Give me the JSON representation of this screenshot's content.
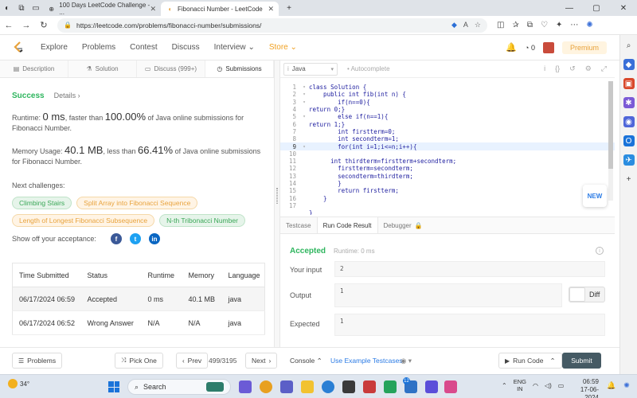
{
  "browser": {
    "tabs": [
      {
        "title": "100 Days LeetCode Challenge - ..."
      },
      {
        "title": "Fibonacci Number - LeetCode"
      }
    ],
    "url": "https://leetcode.com/problems/fibonacci-number/submissions/"
  },
  "nav": {
    "links": [
      "Explore",
      "Problems",
      "Contest",
      "Discuss",
      "Interview",
      "Store"
    ],
    "notification_count": "0",
    "premium": "Premium"
  },
  "problem_tabs": [
    {
      "label": "Description"
    },
    {
      "label": "Solution"
    },
    {
      "label": "Discuss (999+)"
    },
    {
      "label": "Submissions"
    }
  ],
  "result": {
    "status": "Success",
    "details": "Details",
    "runtime_prefix": "Runtime: ",
    "runtime_value": "0 ms",
    "runtime_mid": ", faster than ",
    "runtime_pct": "100.00%",
    "runtime_suffix": " of Java online submissions for Fibonacci Number.",
    "memory_prefix": "Memory Usage: ",
    "memory_value": "40.1 MB",
    "memory_mid": ", less than ",
    "memory_pct": "66.41%",
    "memory_suffix": " of Java online submissions for Fibonacci Number.",
    "next_label": "Next challenges:",
    "challenges": [
      {
        "label": "Climbing Stairs",
        "difficulty": "easy"
      },
      {
        "label": "Split Array into Fibonacci Sequence",
        "difficulty": "medium"
      },
      {
        "label": "Length of Longest Fibonacci Subsequence",
        "difficulty": "medium"
      },
      {
        "label": "N-th Tribonacci Number",
        "difficulty": "easy"
      }
    ],
    "share_label": "Show off your acceptance:"
  },
  "submissions": {
    "headers": [
      "Time Submitted",
      "Status",
      "Runtime",
      "Memory",
      "Language"
    ],
    "rows": [
      {
        "time": "06/17/2024 06:59",
        "status": "Accepted",
        "runtime": "0 ms",
        "memory": "40.1 MB",
        "language": "java"
      },
      {
        "time": "06/17/2024 06:52",
        "status": "Wrong Answer",
        "runtime": "N/A",
        "memory": "N/A",
        "language": "java"
      }
    ]
  },
  "editor": {
    "language": "Java",
    "autocomplete": "Autocomplete",
    "lines": [
      "class Solution {",
      "    public int fib(int n) {",
      "        if(n==0){",
      "return 0;}",
      "        else if(n==1){",
      "return 1;}",
      "        int firstterm=0;",
      "        int secondterm=1;",
      "        for(int i=1;i<=n;i++){",
      "",
      "      int thirdterm=firstterm+secondterm;",
      "        firstterm=secondterm;",
      "        secondterm=thirdterm;",
      "        }",
      "        return firstterm;",
      "    }",
      "",
      "}"
    ],
    "new_badge": "NEW"
  },
  "result_tabs": [
    {
      "label": "Testcase"
    },
    {
      "label": "Run Code Result"
    },
    {
      "label": "Debugger"
    }
  ],
  "run_result": {
    "status": "Accepted",
    "runtime": "Runtime: 0 ms",
    "input_label": "Your input",
    "input_value": "2",
    "output_label": "Output",
    "output_value": "1",
    "expected_label": "Expected",
    "expected_value": "1",
    "diff_label": "Diff"
  },
  "bottom": {
    "problems": "Problems",
    "pick_one": "Pick One",
    "prev": "Prev",
    "page": "499/3195",
    "next": "Next",
    "console": "Console",
    "example": "Use Example Testcases",
    "run_code": "Run Code",
    "submit": "Submit"
  },
  "taskbar": {
    "temperature": "34°",
    "search": "Search",
    "lang_line1": "ENG",
    "lang_line2": "IN",
    "time": "06:59",
    "date": "17-06-2024",
    "badge": "12"
  }
}
